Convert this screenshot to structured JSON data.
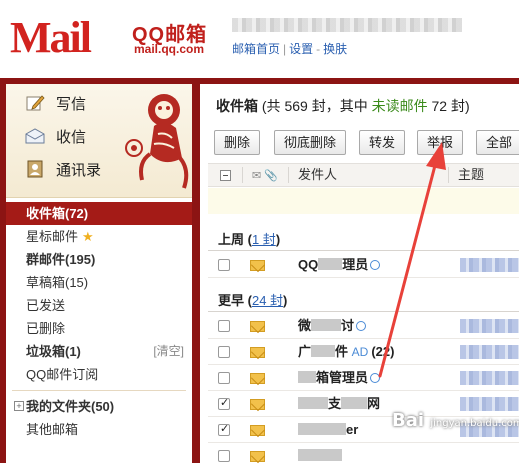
{
  "header": {
    "logo_text": "Mail",
    "brand_name": "QQ邮箱",
    "brand_url": "mail.qq.com",
    "nav": [
      {
        "label": "邮箱首页"
      },
      {
        "label": "设置"
      },
      {
        "label": "换肤"
      }
    ],
    "nav_sep_1": "|",
    "nav_sep_2": "-"
  },
  "actions": {
    "write": "写信",
    "inbox": "收信",
    "contacts": "通讯录"
  },
  "folders": {
    "inbox": "收件箱(72)",
    "starred": "星标邮件",
    "groups": "群邮件(195)",
    "drafts": "草稿箱(15)",
    "sent": "已发送",
    "deleted": "已删除",
    "spam": "垃圾箱(1)",
    "spam_clear": "[清空]",
    "subscriptions": "QQ邮件订阅",
    "my_folders": "我的文件夹(50)",
    "other": "其他邮箱"
  },
  "main": {
    "title": "收件箱",
    "summary_pre": "(共 569 封，其中",
    "summary_unread": "未读邮件",
    "summary_post": "72 封)",
    "toolbar": {
      "delete": "删除",
      "purge": "彻底删除",
      "forward": "转发",
      "report": "举报",
      "all": "全部"
    },
    "columns": {
      "sender": "发件人",
      "subject": "主题"
    },
    "groups": [
      {
        "label": "上周",
        "count": "1 封"
      },
      {
        "label": "更早",
        "count": "24 封"
      }
    ],
    "rows": {
      "r1_sender": "QQ",
      "r1_sender_tail": "理员",
      "r2_sender": "微",
      "r2_sender_tail": "讨",
      "r3_sender": "广",
      "r3_sender_mid": "件",
      "r3_ad": "AD",
      "r3_count": "(22)",
      "r4_sender_tail": "箱管理员",
      "r5_sender_tail": "支",
      "r5_sender_end": "网",
      "r6_sender_tail": "er"
    }
  },
  "watermark": {
    "text": "Bai",
    "url": "jingyan.baidu.com"
  },
  "colors": {
    "brand_red": "#c0201c",
    "frame": "#8c1413",
    "active_folder": "#a41b17",
    "unread_green": "#3a8a1a",
    "link_blue": "#2a5fb0",
    "annotation_arrow": "#e8413a"
  }
}
